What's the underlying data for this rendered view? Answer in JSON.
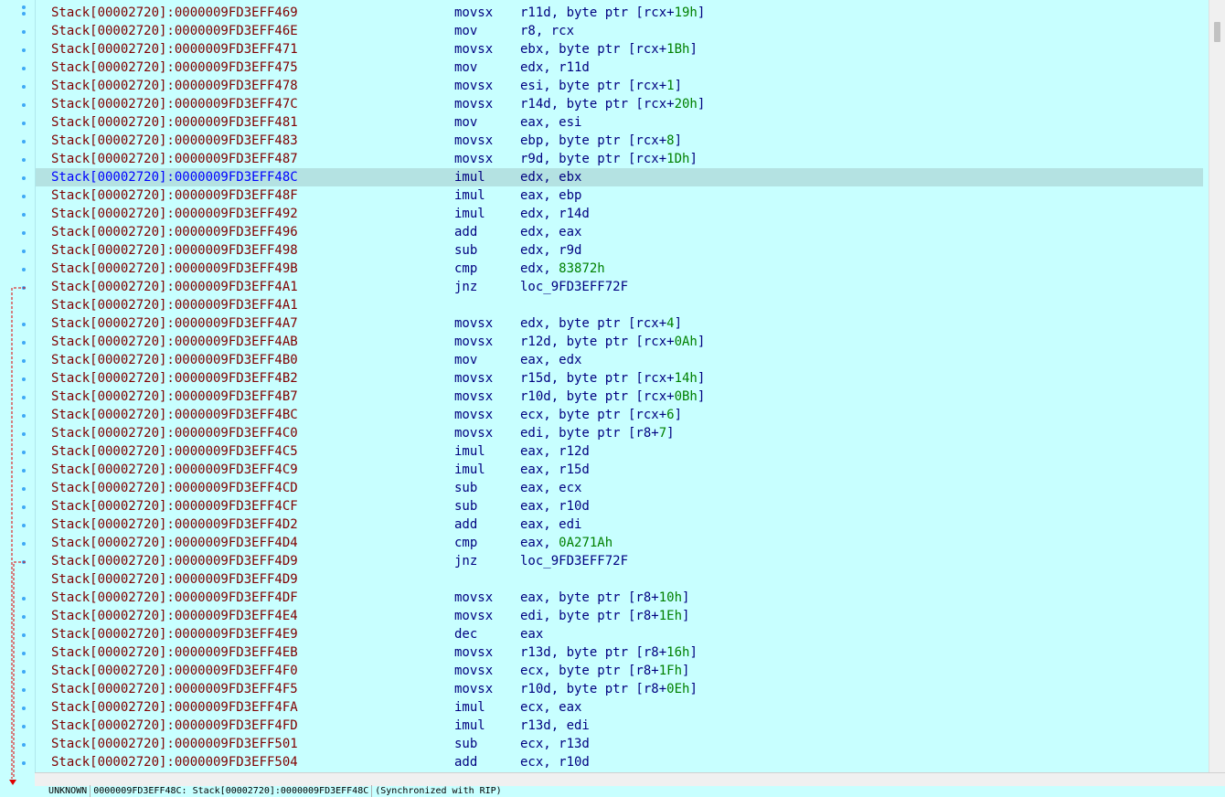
{
  "listing": [
    {
      "addr": "Stack[00002720]:0000009FD3EFF469",
      "mnem": "movsx",
      "ops": [
        {
          "t": "r11d, byte ptr [rcx+"
        },
        {
          "t": "19h",
          "n": true
        },
        {
          "t": "]"
        }
      ]
    },
    {
      "addr": "Stack[00002720]:0000009FD3EFF46E",
      "mnem": "mov",
      "ops": [
        {
          "t": "r8, rcx"
        }
      ]
    },
    {
      "addr": "Stack[00002720]:0000009FD3EFF471",
      "mnem": "movsx",
      "ops": [
        {
          "t": "ebx, byte ptr [rcx+"
        },
        {
          "t": "1Bh",
          "n": true
        },
        {
          "t": "]"
        }
      ]
    },
    {
      "addr": "Stack[00002720]:0000009FD3EFF475",
      "mnem": "mov",
      "ops": [
        {
          "t": "edx, r11d"
        }
      ]
    },
    {
      "addr": "Stack[00002720]:0000009FD3EFF478",
      "mnem": "movsx",
      "ops": [
        {
          "t": "esi, byte ptr [rcx+"
        },
        {
          "t": "1",
          "n": true
        },
        {
          "t": "]"
        }
      ]
    },
    {
      "addr": "Stack[00002720]:0000009FD3EFF47C",
      "mnem": "movsx",
      "ops": [
        {
          "t": "r14d, byte ptr [rcx+"
        },
        {
          "t": "20h",
          "n": true
        },
        {
          "t": "]"
        }
      ]
    },
    {
      "addr": "Stack[00002720]:0000009FD3EFF481",
      "mnem": "mov",
      "ops": [
        {
          "t": "eax, esi"
        }
      ]
    },
    {
      "addr": "Stack[00002720]:0000009FD3EFF483",
      "mnem": "movsx",
      "ops": [
        {
          "t": "ebp, byte ptr [rcx+"
        },
        {
          "t": "8",
          "n": true
        },
        {
          "t": "]"
        }
      ]
    },
    {
      "addr": "Stack[00002720]:0000009FD3EFF487",
      "mnem": "movsx",
      "ops": [
        {
          "t": "r9d, byte ptr [rcx+"
        },
        {
          "t": "1Dh",
          "n": true
        },
        {
          "t": "]"
        }
      ]
    },
    {
      "addr": "Stack[00002720]:0000009FD3EFF48C",
      "mnem": "imul",
      "ops": [
        {
          "t": "edx, ebx"
        }
      ],
      "selected": true
    },
    {
      "addr": "Stack[00002720]:0000009FD3EFF48F",
      "mnem": "imul",
      "ops": [
        {
          "t": "eax, ebp"
        }
      ]
    },
    {
      "addr": "Stack[00002720]:0000009FD3EFF492",
      "mnem": "imul",
      "ops": [
        {
          "t": "edx, r14d"
        }
      ]
    },
    {
      "addr": "Stack[00002720]:0000009FD3EFF496",
      "mnem": "add",
      "ops": [
        {
          "t": "edx, eax"
        }
      ]
    },
    {
      "addr": "Stack[00002720]:0000009FD3EFF498",
      "mnem": "sub",
      "ops": [
        {
          "t": "edx, r9d"
        }
      ]
    },
    {
      "addr": "Stack[00002720]:0000009FD3EFF49B",
      "mnem": "cmp",
      "ops": [
        {
          "t": "edx, "
        },
        {
          "t": "83872h",
          "n": true
        }
      ]
    },
    {
      "addr": "Stack[00002720]:0000009FD3EFF4A1",
      "mnem": "jnz",
      "ops": [
        {
          "t": "loc_9FD3EFF72F"
        }
      ]
    },
    {
      "addr": "Stack[00002720]:0000009FD3EFF4A1",
      "mnem": "",
      "ops": []
    },
    {
      "addr": "Stack[00002720]:0000009FD3EFF4A7",
      "mnem": "movsx",
      "ops": [
        {
          "t": "edx, byte ptr [rcx+"
        },
        {
          "t": "4",
          "n": true
        },
        {
          "t": "]"
        }
      ]
    },
    {
      "addr": "Stack[00002720]:0000009FD3EFF4AB",
      "mnem": "movsx",
      "ops": [
        {
          "t": "r12d, byte ptr [rcx+"
        },
        {
          "t": "0Ah",
          "n": true
        },
        {
          "t": "]"
        }
      ]
    },
    {
      "addr": "Stack[00002720]:0000009FD3EFF4B0",
      "mnem": "mov",
      "ops": [
        {
          "t": "eax, edx"
        }
      ]
    },
    {
      "addr": "Stack[00002720]:0000009FD3EFF4B2",
      "mnem": "movsx",
      "ops": [
        {
          "t": "r15d, byte ptr [rcx+"
        },
        {
          "t": "14h",
          "n": true
        },
        {
          "t": "]"
        }
      ]
    },
    {
      "addr": "Stack[00002720]:0000009FD3EFF4B7",
      "mnem": "movsx",
      "ops": [
        {
          "t": "r10d, byte ptr [rcx+"
        },
        {
          "t": "0Bh",
          "n": true
        },
        {
          "t": "]"
        }
      ]
    },
    {
      "addr": "Stack[00002720]:0000009FD3EFF4BC",
      "mnem": "movsx",
      "ops": [
        {
          "t": "ecx, byte ptr [rcx+"
        },
        {
          "t": "6",
          "n": true
        },
        {
          "t": "]"
        }
      ]
    },
    {
      "addr": "Stack[00002720]:0000009FD3EFF4C0",
      "mnem": "movsx",
      "ops": [
        {
          "t": "edi, byte ptr [r8+"
        },
        {
          "t": "7",
          "n": true
        },
        {
          "t": "]"
        }
      ]
    },
    {
      "addr": "Stack[00002720]:0000009FD3EFF4C5",
      "mnem": "imul",
      "ops": [
        {
          "t": "eax, r12d"
        }
      ]
    },
    {
      "addr": "Stack[00002720]:0000009FD3EFF4C9",
      "mnem": "imul",
      "ops": [
        {
          "t": "eax, r15d"
        }
      ]
    },
    {
      "addr": "Stack[00002720]:0000009FD3EFF4CD",
      "mnem": "sub",
      "ops": [
        {
          "t": "eax, ecx"
        }
      ]
    },
    {
      "addr": "Stack[00002720]:0000009FD3EFF4CF",
      "mnem": "sub",
      "ops": [
        {
          "t": "eax, r10d"
        }
      ]
    },
    {
      "addr": "Stack[00002720]:0000009FD3EFF4D2",
      "mnem": "add",
      "ops": [
        {
          "t": "eax, edi"
        }
      ]
    },
    {
      "addr": "Stack[00002720]:0000009FD3EFF4D4",
      "mnem": "cmp",
      "ops": [
        {
          "t": "eax, "
        },
        {
          "t": "0A271Ah",
          "n": true
        }
      ]
    },
    {
      "addr": "Stack[00002720]:0000009FD3EFF4D9",
      "mnem": "jnz",
      "ops": [
        {
          "t": "loc_9FD3EFF72F"
        }
      ]
    },
    {
      "addr": "Stack[00002720]:0000009FD3EFF4D9",
      "mnem": "",
      "ops": []
    },
    {
      "addr": "Stack[00002720]:0000009FD3EFF4DF",
      "mnem": "movsx",
      "ops": [
        {
          "t": "eax, byte ptr [r8+"
        },
        {
          "t": "10h",
          "n": true
        },
        {
          "t": "]"
        }
      ]
    },
    {
      "addr": "Stack[00002720]:0000009FD3EFF4E4",
      "mnem": "movsx",
      "ops": [
        {
          "t": "edi, byte ptr [r8+"
        },
        {
          "t": "1Eh",
          "n": true
        },
        {
          "t": "]"
        }
      ]
    },
    {
      "addr": "Stack[00002720]:0000009FD3EFF4E9",
      "mnem": "dec",
      "ops": [
        {
          "t": "eax"
        }
      ]
    },
    {
      "addr": "Stack[00002720]:0000009FD3EFF4EB",
      "mnem": "movsx",
      "ops": [
        {
          "t": "r13d, byte ptr [r8+"
        },
        {
          "t": "16h",
          "n": true
        },
        {
          "t": "]"
        }
      ]
    },
    {
      "addr": "Stack[00002720]:0000009FD3EFF4F0",
      "mnem": "movsx",
      "ops": [
        {
          "t": "ecx, byte ptr [r8+"
        },
        {
          "t": "1Fh",
          "n": true
        },
        {
          "t": "]"
        }
      ]
    },
    {
      "addr": "Stack[00002720]:0000009FD3EFF4F5",
      "mnem": "movsx",
      "ops": [
        {
          "t": "r10d, byte ptr [r8+"
        },
        {
          "t": "0Eh",
          "n": true
        },
        {
          "t": "]"
        }
      ]
    },
    {
      "addr": "Stack[00002720]:0000009FD3EFF4FA",
      "mnem": "imul",
      "ops": [
        {
          "t": "ecx, eax"
        }
      ]
    },
    {
      "addr": "Stack[00002720]:0000009FD3EFF4FD",
      "mnem": "imul",
      "ops": [
        {
          "t": "r13d, edi"
        }
      ]
    },
    {
      "addr": "Stack[00002720]:0000009FD3EFF501",
      "mnem": "sub",
      "ops": [
        {
          "t": "ecx, r13d"
        }
      ]
    },
    {
      "addr": "Stack[00002720]:0000009FD3EFF504",
      "mnem": "add",
      "ops": [
        {
          "t": "ecx, r10d"
        }
      ]
    }
  ],
  "statusbar": {
    "segment_type": "UNKNOWN",
    "location": "0000009FD3EFF48C: Stack[00002720]:0000009FD3EFF48C",
    "sync": "(Synchronized with RIP)"
  },
  "colors": {
    "background": "#c8ffff",
    "address": "#800000",
    "instruction": "#000080",
    "number": "#008000",
    "selected_row": "#b4e2e2",
    "flow_arrow": "#e00000",
    "gutter_dot": "#3fa9f5"
  }
}
